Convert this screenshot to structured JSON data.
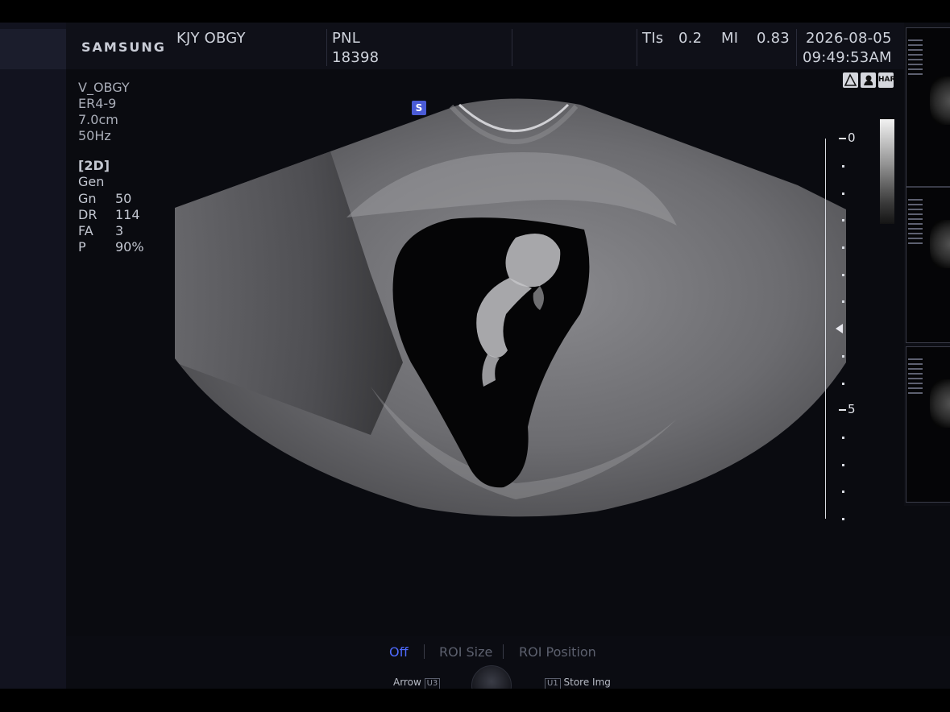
{
  "header": {
    "brand": "SAMSUNG",
    "institution": "KJY OBGY",
    "patient_label": "PNL",
    "patient_id": "18398",
    "tis_label": "TIs",
    "tis_value": "0.2",
    "mi_label": "MI",
    "mi_value": "0.83",
    "date": "2026-08-05",
    "time": "09:49:53AM"
  },
  "probe": {
    "preset": "V_OBGY",
    "transducer": "ER4-9",
    "depth": "7.0cm",
    "frame_rate": "50Hz"
  },
  "mode": {
    "title": "[2D]",
    "type": "Gen",
    "params": [
      {
        "label": "Gn",
        "value": "50"
      },
      {
        "label": "DR",
        "value": "114"
      },
      {
        "label": "FA",
        "value": "3"
      },
      {
        "label": "P",
        "value": "90%"
      }
    ]
  },
  "depth_scale": {
    "top_label": "0",
    "mid_label": "5"
  },
  "image_marker": "S",
  "toolbar_icons": [
    {
      "name": "body-marker-icon",
      "text": ""
    },
    {
      "name": "fetus-icon",
      "text": ""
    },
    {
      "name": "har-icon",
      "text": "HAR"
    }
  ],
  "controls": {
    "off": "Off",
    "roi_size": "ROI Size",
    "roi_position": "ROI Position",
    "arrow": "Arrow",
    "arrow_key": "U3",
    "store_key": "U1",
    "store": "Store Img"
  },
  "colors": {
    "active_control": "#4f6bff",
    "inactive_control": "#5c606e",
    "marker": "#4a5bd6"
  }
}
